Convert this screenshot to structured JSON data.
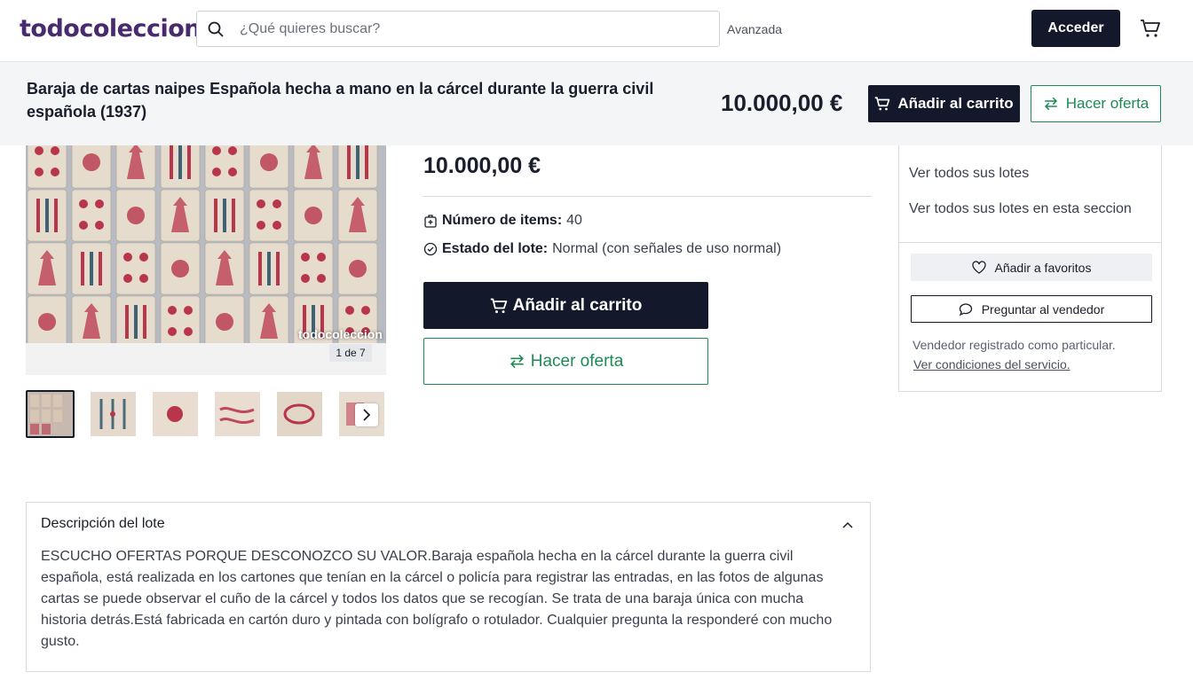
{
  "header": {
    "logo": "todocoleccion",
    "search_placeholder": "¿Qué quieres buscar?",
    "advanced_label": "Avanzada",
    "login_label": "Acceder"
  },
  "sticky_bar": {
    "title": "Baraja de cartas naipes Española hecha a mano en la cárcel durante la guerra civil española (1937)",
    "price": "10.000,00 €",
    "add_to_cart": "Añadir al carrito",
    "make_offer": "Hacer oferta"
  },
  "gallery": {
    "watermark": "todocoleccion",
    "counter": "1 de 7",
    "thumbnail_count": 6
  },
  "product": {
    "price": "10.000,00 €",
    "items_label": "Número de items:",
    "items_value": "40",
    "state_label": "Estado del lote:",
    "state_value": "Normal (con señales de uso normal)",
    "add_to_cart": "Añadir al carrito",
    "make_offer": "Hacer oferta"
  },
  "seller": {
    "links": [
      "Ver todos sus lotes",
      "Ver todos sus lotes en esta seccion"
    ],
    "favorite_label": "Añadir a favoritos",
    "ask_label": "Preguntar al vendedor",
    "note": "Vendedor registrado como particular.",
    "terms_link": "Ver condiciones del servicio."
  },
  "description": {
    "title": "Descripción del lote",
    "body": "ESCUCHO OFERTAS PORQUE DESCONOZCO SU VALOR.Baraja española hecha en la cárcel durante la guerra civil española, está realizada en los cartones que tenían en la cárcel o policía para registrar las entradas, en las fotos de algunas cartas se puede observar el cuño de la cárcel y todos los datos que se recogían. Se trata de una baraja única con mucha historia detrás.Está fabricada en cartón duro y pintada con bolígrafo o rotulador. Cualquier pregunta la responderé con mucho gusto."
  },
  "colors": {
    "brand": "#4a2a6f",
    "dark": "#13192b",
    "offer_green": "#1d8a55",
    "card_red": "#b8354a"
  }
}
